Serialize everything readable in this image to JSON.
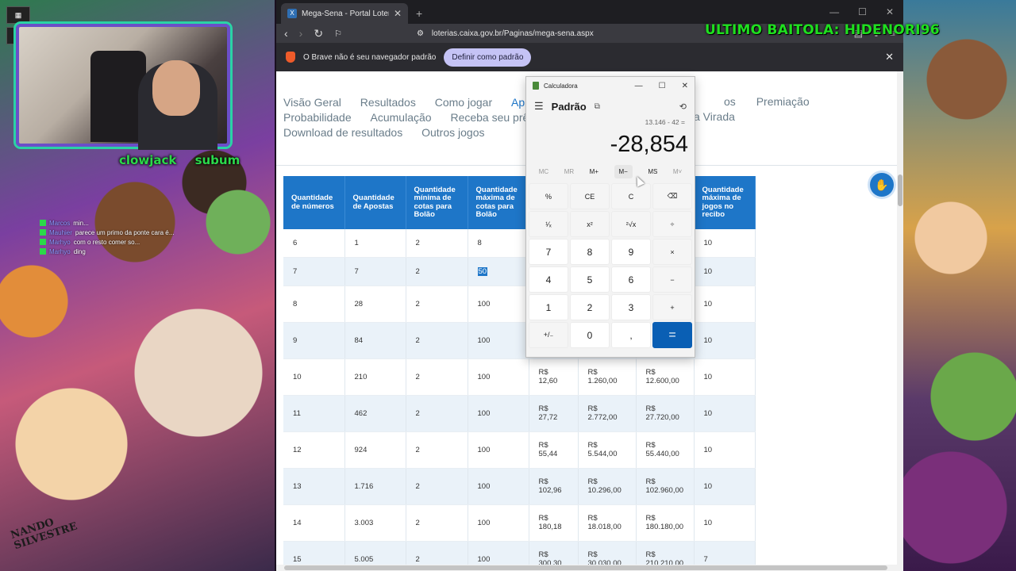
{
  "overlay": {
    "title": "ULTIMO BAITOLA: HIDENORI96",
    "cam_names": [
      "clowjack",
      "subum"
    ],
    "chat": [
      {
        "user": "Marcos",
        "text": "min..."
      },
      {
        "user": "Mauhier",
        "text": "parece um primo da ponte cara é..."
      },
      {
        "user": "Marhyo",
        "text": "com o resto comer so... "
      },
      {
        "user": "Marhyo",
        "text": "ding"
      }
    ],
    "signature": "NANDO SILVESTRE"
  },
  "browser": {
    "tab_title": "Mega-Sena - Portal Loterias | CAIX",
    "url": "loterias.caixa.gov.br/Paginas/mega-sena.aspx",
    "infobar_text": "O Brave não é seu navegador padrão",
    "default_button": "Definir como padrão"
  },
  "page": {
    "nav_row1": [
      "Visão Geral",
      "Resultados",
      "Como jogar",
      "Ap"
    ],
    "nav_row1_right": [
      "os",
      "Premiação"
    ],
    "nav_row2": [
      "Probabilidade",
      "Acumulação",
      "Receba seu prê"
    ],
    "nav_row2_right": "a Virada",
    "nav_row3": [
      "Download de resultados",
      "Outros jogos"
    ],
    "table": {
      "headers": [
        "Quantidade de números",
        "Quantidade de Apostas",
        "Quantidade mínima de cotas para Bolão",
        "Quantidade máxima de cotas para Bolão",
        "",
        "",
        "",
        "Quantidade máxima de jogos no recibo"
      ],
      "rows": [
        [
          "6",
          "1",
          "2",
          "8",
          "",
          "",
          "",
          "10"
        ],
        [
          "7",
          "7",
          "2",
          "50",
          "",
          "",
          "",
          "10"
        ],
        [
          "8",
          "28",
          "2",
          "100",
          "",
          "",
          "",
          "10"
        ],
        [
          "9",
          "84",
          "2",
          "100",
          "",
          "",
          "",
          "10"
        ],
        [
          "10",
          "210",
          "2",
          "100",
          "R$ 12,60",
          "R$ 1.260,00",
          "R$ 12.600,00",
          "10"
        ],
        [
          "11",
          "462",
          "2",
          "100",
          "R$ 27,72",
          "R$ 2.772,00",
          "R$ 27.720,00",
          "10"
        ],
        [
          "12",
          "924",
          "2",
          "100",
          "R$ 55,44",
          "R$ 5.544,00",
          "R$ 55.440,00",
          "10"
        ],
        [
          "13",
          "1.716",
          "2",
          "100",
          "R$ 102,96",
          "R$ 10.296,00",
          "R$ 102.960,00",
          "10"
        ],
        [
          "14",
          "3.003",
          "2",
          "100",
          "R$ 180,18",
          "R$ 18.018,00",
          "R$ 180.180,00",
          "10"
        ],
        [
          "15",
          "5.005",
          "2",
          "100",
          "R$ 300,30",
          "R$ 30.030,00",
          "R$ 210.210,00",
          "7"
        ]
      ]
    }
  },
  "calculator": {
    "window_title": "Calculadora",
    "mode": "Padrão",
    "expression": "13.146 - 42 =",
    "result": "-28,854",
    "memory": [
      "MC",
      "MR",
      "M+",
      "M−",
      "MS",
      "M˅"
    ],
    "keys": [
      [
        "%",
        "CE",
        "C",
        "⌫"
      ],
      [
        "¹⁄ₓ",
        "x²",
        "²√x",
        "÷"
      ],
      [
        "7",
        "8",
        "9",
        "×"
      ],
      [
        "4",
        "5",
        "6",
        "−"
      ],
      [
        "1",
        "2",
        "3",
        "+"
      ],
      [
        "+/₋",
        "0",
        ",",
        "="
      ]
    ]
  }
}
